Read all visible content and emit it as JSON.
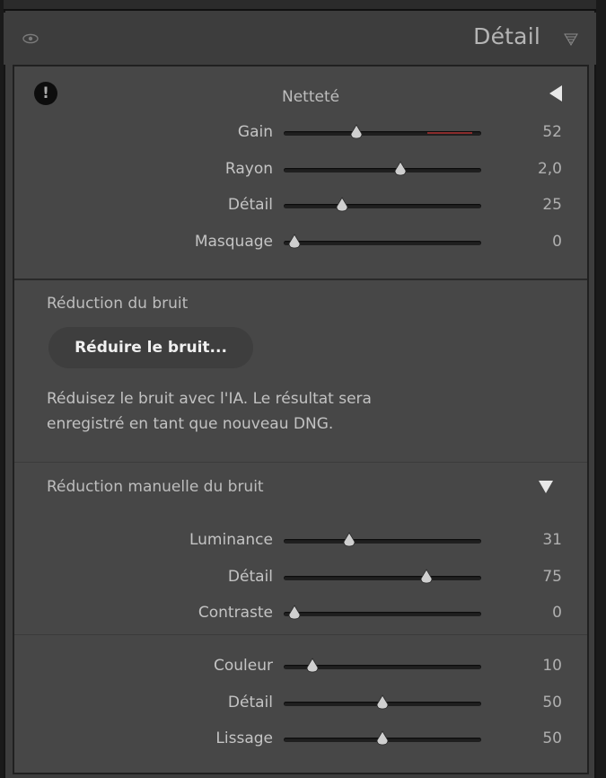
{
  "header": {
    "title": "Détail"
  },
  "sharpening": {
    "title": "Netteté",
    "sliders": [
      {
        "label": "Gain",
        "value": "52",
        "fraction": 0.35
      },
      {
        "label": "Rayon",
        "value": "2,0",
        "fraction": 0.6
      },
      {
        "label": "Détail",
        "value": "25",
        "fraction": 0.27
      },
      {
        "label": "Masquage",
        "value": "0",
        "fraction": 0.0
      }
    ]
  },
  "noise": {
    "title": "Réduction du bruit",
    "button_label": "Réduire le bruit...",
    "description_line1": "Réduisez le bruit avec l'IA. Le résultat sera",
    "description_line2": "enregistré en tant que nouveau DNG."
  },
  "manual_noise": {
    "title": "Réduction manuelle du bruit",
    "luminance_sliders": [
      {
        "label": "Luminance",
        "value": "31",
        "fraction": 0.31
      },
      {
        "label": "Détail",
        "value": "75",
        "fraction": 0.75
      },
      {
        "label": "Contraste",
        "value": "0",
        "fraction": 0.0
      }
    ],
    "color_sliders": [
      {
        "label": "Couleur",
        "value": "10",
        "fraction": 0.1
      },
      {
        "label": "Détail",
        "value": "50",
        "fraction": 0.5
      },
      {
        "label": "Lissage",
        "value": "50",
        "fraction": 0.5
      }
    ]
  },
  "icons": {
    "visibility": "eye-icon",
    "panel_menu": "filter-triangle-icon",
    "warning": "exclamation-icon",
    "collapse_sharpening": "triangle-left-icon",
    "collapse_manual": "triangle-down-icon"
  },
  "colors": {
    "panel_bg": "#474747",
    "header_bg": "#3d3d3d",
    "track": "#1f1f1f",
    "thumb": "#cfcfcf",
    "gain_warning": "#8a2c2c"
  }
}
